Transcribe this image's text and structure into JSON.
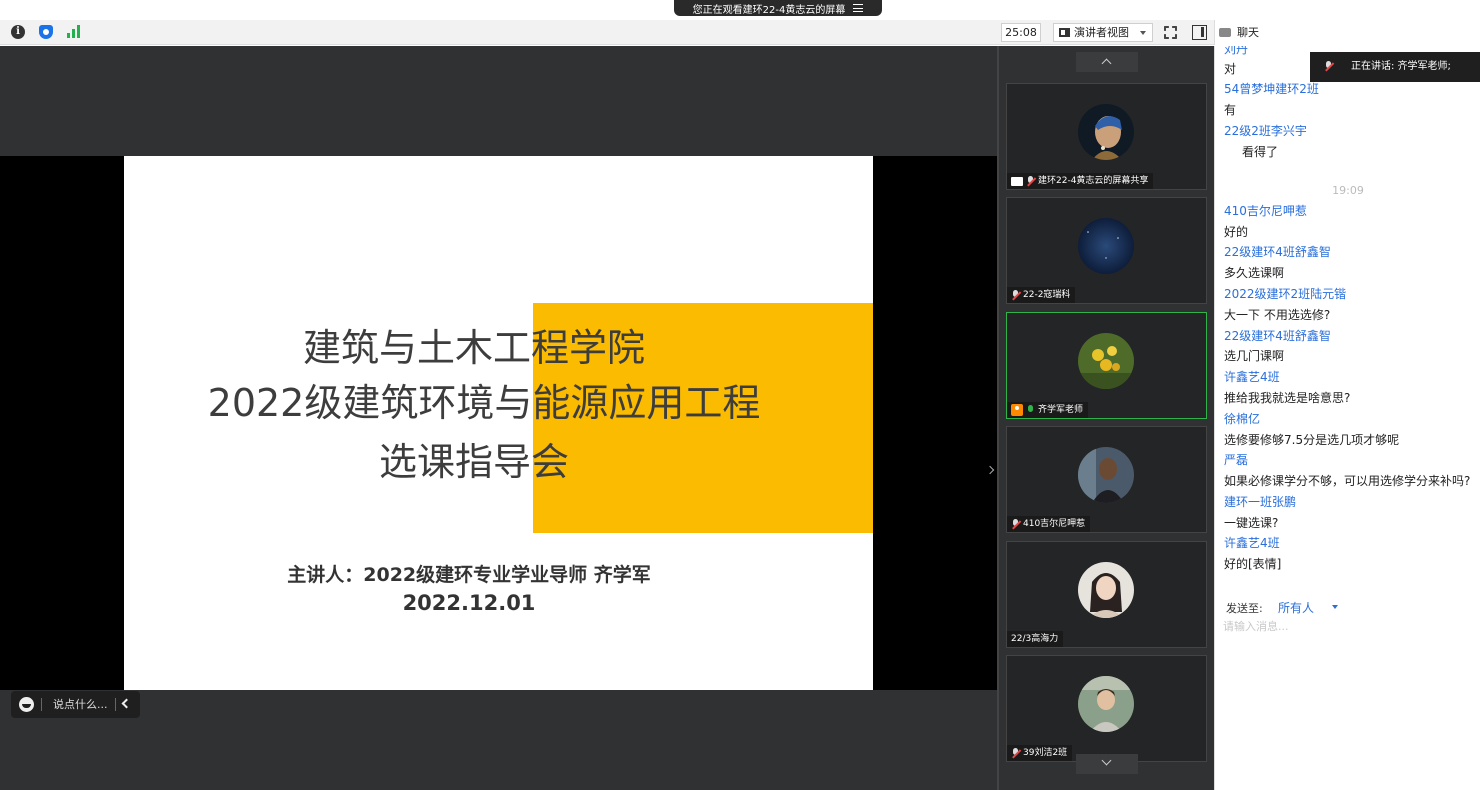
{
  "banner": {
    "text": "您正在观看建环22-4黄志云的屏幕"
  },
  "toolbar": {
    "timer": "25:08",
    "view_mode": "演讲者视图"
  },
  "chat_header": {
    "title": "聊天"
  },
  "slide": {
    "title_line1": "建筑与土木工程学院",
    "title_line2": "2022级建筑环境与能源应用工程",
    "title_line3": "选课指导会",
    "presenter": "主讲人：2022级建环专业学业导师 齐学军",
    "date": "2022.12.01",
    "accent_color": "#fbbb00"
  },
  "reaction": {
    "placeholder": "说点什么..."
  },
  "participants": [
    {
      "name": "建环22-4黄志云的屏幕共享",
      "type": "screen-share",
      "mic": "muted"
    },
    {
      "name": "22-2寇瑞科",
      "type": "participant",
      "mic": "muted"
    },
    {
      "name": "齐学军老师",
      "type": "host",
      "mic": "on",
      "active": true
    },
    {
      "name": "410吉尔尼呷惹",
      "type": "participant",
      "mic": "muted"
    },
    {
      "name": "22/3高海力",
      "type": "participant",
      "mic": "none"
    },
    {
      "name": "39刘洁2班",
      "type": "participant",
      "mic": "muted"
    }
  ],
  "speaking": {
    "text": "正在讲话: 齐学军老师;"
  },
  "chat": {
    "cut_name": "刘丹",
    "messages_before": [
      {
        "name": null,
        "text": "对"
      },
      {
        "name": "54曾梦坤建环2班",
        "text": "有"
      },
      {
        "name": "22级2班李兴宇",
        "text": "看得了"
      }
    ],
    "time_divider": "19:09",
    "messages_after": [
      {
        "name": "410吉尔尼呷惹",
        "text": "好的"
      },
      {
        "name": "22级建环4班舒鑫智",
        "text": "多久选课啊"
      },
      {
        "name": "2022级建环2班陆元锴",
        "text": "大一下 不用选选修?"
      },
      {
        "name": "22级建环4班舒鑫智",
        "text": "选几门课啊"
      },
      {
        "name": "许鑫艺4班",
        "text": "推给我我就选是啥意思?"
      },
      {
        "name": "徐棉亿",
        "text": "选修要修够7.5分是选几项才够呢"
      },
      {
        "name": "严磊",
        "text": "如果必修课学分不够，可以用选修学分来补吗?"
      },
      {
        "name": "建环一班张鹏",
        "text": "一键选课?"
      },
      {
        "name": "许鑫艺4班",
        "text": "好的[表情]"
      }
    ]
  },
  "compose": {
    "send_to_label": "发送至:",
    "send_to_value": "所有人",
    "placeholder": "请输入消息..."
  }
}
